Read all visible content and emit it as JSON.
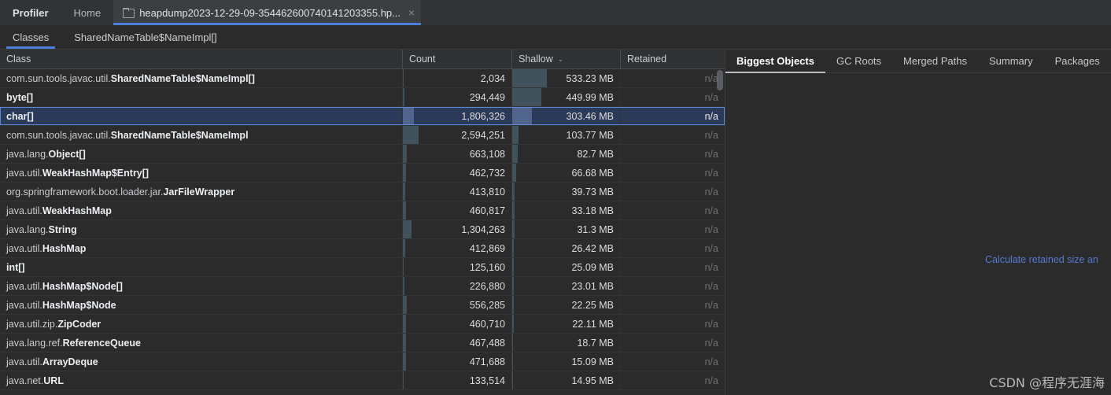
{
  "window": {
    "topbar": {
      "app_label": "Profiler",
      "home_label": "Home",
      "file_tab_label": "heapdump2023-12-29-09-354462600740141203355.hp...",
      "file_tab_close": "×",
      "accent_color": "#4a7eda"
    },
    "subtabs": [
      {
        "label": "Classes",
        "active": true
      },
      {
        "label": "SharedNameTable$NameImpl[]",
        "active": false
      }
    ]
  },
  "table": {
    "columns": [
      {
        "key": "class",
        "label": "Class",
        "sorted": false
      },
      {
        "key": "count",
        "label": "Count",
        "sorted": false
      },
      {
        "key": "shallow",
        "label": "Shallow",
        "sorted": true,
        "caret": "⌄"
      },
      {
        "key": "retained",
        "label": "Retained",
        "sorted": false
      }
    ],
    "rows": [
      {
        "package": "com.sun.tools.javac.util.",
        "class_name": "SharedNameTable$NameImpl[]",
        "count": "2,034",
        "shallow": "533.23 MB",
        "retained": "n/a",
        "count_bar_pct": 0,
        "shallow_bar_pct": 100,
        "selected": false
      },
      {
        "package": "",
        "class_name": "byte[]",
        "count": "294,449",
        "shallow": "449.99 MB",
        "retained": "n/a",
        "count_bar_pct": 3,
        "shallow_bar_pct": 84,
        "selected": false
      },
      {
        "package": "",
        "class_name": "char[]",
        "count": "1,806,326",
        "shallow": "303.46 MB",
        "retained": "n/a",
        "count_bar_pct": 19,
        "shallow_bar_pct": 57,
        "selected": true
      },
      {
        "package": "com.sun.tools.javac.util.",
        "class_name": "SharedNameTable$NameImpl",
        "count": "2,594,251",
        "shallow": "103.77 MB",
        "retained": "n/a",
        "count_bar_pct": 27,
        "shallow_bar_pct": 19,
        "selected": false
      },
      {
        "package": "java.lang.",
        "class_name": "Object[]",
        "count": "663,108",
        "shallow": "82.7 MB",
        "retained": "n/a",
        "count_bar_pct": 7,
        "shallow_bar_pct": 15,
        "selected": false
      },
      {
        "package": "java.util.",
        "class_name": "WeakHashMap$Entry[]",
        "count": "462,732",
        "shallow": "66.68 MB",
        "retained": "n/a",
        "count_bar_pct": 5,
        "shallow_bar_pct": 12,
        "selected": false
      },
      {
        "package": "org.springframework.boot.loader.jar.",
        "class_name": "JarFileWrapper",
        "count": "413,810",
        "shallow": "39.73 MB",
        "retained": "n/a",
        "count_bar_pct": 4,
        "shallow_bar_pct": 7,
        "selected": false
      },
      {
        "package": "java.util.",
        "class_name": "WeakHashMap",
        "count": "460,817",
        "shallow": "33.18 MB",
        "retained": "n/a",
        "count_bar_pct": 5,
        "shallow_bar_pct": 6,
        "selected": false
      },
      {
        "package": "java.lang.",
        "class_name": "String",
        "count": "1,304,263",
        "shallow": "31.3 MB",
        "retained": "n/a",
        "count_bar_pct": 14,
        "shallow_bar_pct": 6,
        "selected": false
      },
      {
        "package": "java.util.",
        "class_name": "HashMap",
        "count": "412,869",
        "shallow": "26.42 MB",
        "retained": "n/a",
        "count_bar_pct": 4,
        "shallow_bar_pct": 5,
        "selected": false
      },
      {
        "package": "",
        "class_name": "int[]",
        "count": "125,160",
        "shallow": "25.09 MB",
        "retained": "n/a",
        "count_bar_pct": 1,
        "shallow_bar_pct": 5,
        "selected": false
      },
      {
        "package": "java.util.",
        "class_name": "HashMap$Node[]",
        "count": "226,880",
        "shallow": "23.01 MB",
        "retained": "n/a",
        "count_bar_pct": 2,
        "shallow_bar_pct": 4,
        "selected": false
      },
      {
        "package": "java.util.",
        "class_name": "HashMap$Node",
        "count": "556,285",
        "shallow": "22.25 MB",
        "retained": "n/a",
        "count_bar_pct": 6,
        "shallow_bar_pct": 4,
        "selected": false
      },
      {
        "package": "java.util.zip.",
        "class_name": "ZipCoder",
        "count": "460,710",
        "shallow": "22.11 MB",
        "retained": "n/a",
        "count_bar_pct": 5,
        "shallow_bar_pct": 4,
        "selected": false
      },
      {
        "package": "java.lang.ref.",
        "class_name": "ReferenceQueue",
        "count": "467,488",
        "shallow": "18.7 MB",
        "retained": "n/a",
        "count_bar_pct": 5,
        "shallow_bar_pct": 3,
        "selected": false
      },
      {
        "package": "java.util.",
        "class_name": "ArrayDeque",
        "count": "471,688",
        "shallow": "15.09 MB",
        "retained": "n/a",
        "count_bar_pct": 5,
        "shallow_bar_pct": 3,
        "selected": false
      },
      {
        "package": "java.net.",
        "class_name": "URL",
        "count": "133,514",
        "shallow": "14.95 MB",
        "retained": "n/a",
        "count_bar_pct": 1,
        "shallow_bar_pct": 3,
        "selected": false
      }
    ]
  },
  "right_panel": {
    "tabs": [
      {
        "label": "Biggest Objects",
        "active": true
      },
      {
        "label": "GC Roots",
        "active": false
      },
      {
        "label": "Merged Paths",
        "active": false
      },
      {
        "label": "Summary",
        "active": false
      },
      {
        "label": "Packages",
        "active": false
      }
    ],
    "calculate_link": "Calculate retained size an"
  },
  "watermark": "CSDN @程序无涯海"
}
